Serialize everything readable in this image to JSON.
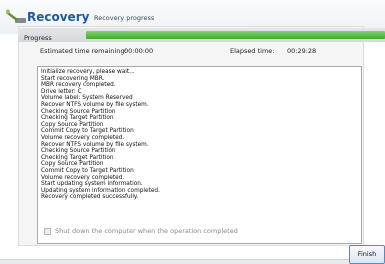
{
  "header": {
    "title": "Recovery",
    "subtitle": "Recovery progress",
    "app_icon": "recovery-wand-icon"
  },
  "progress": {
    "label": "Progress",
    "fraction": 1.0,
    "color": "#3faa2b"
  },
  "times": {
    "remaining_label": "Estimated time remaining:",
    "remaining_value": "00:00:00",
    "elapsed_label": "Elapsed time:",
    "elapsed_value": "00:29:28"
  },
  "log": [
    "Initialize recovery, please wait...",
    "Start recovering MBR.",
    "MBR recovery completed.",
    "Drive letter: C",
    "Volume label: System Reserved",
    "Recover NTFS volume by file system.",
    "Checking Source Partition",
    "Checking Target Partition",
    "Copy Source Partition",
    "Commit Copy to Target Partition",
    "Volume recovery completed.",
    "Recover NTFS volume by file system.",
    "Checking Source Partition",
    "Checking Target Partition",
    "Copy Source Partition",
    "Commit Copy to Target Partition",
    "Volume recovery completed.",
    "Start updating system information.",
    "Updating system information completed.",
    "Recovery completed successfully."
  ],
  "shutdown_option": {
    "label": "Shut down the computer when the operation completed",
    "checked": false
  },
  "buttons": {
    "finish_label": "Finish"
  }
}
